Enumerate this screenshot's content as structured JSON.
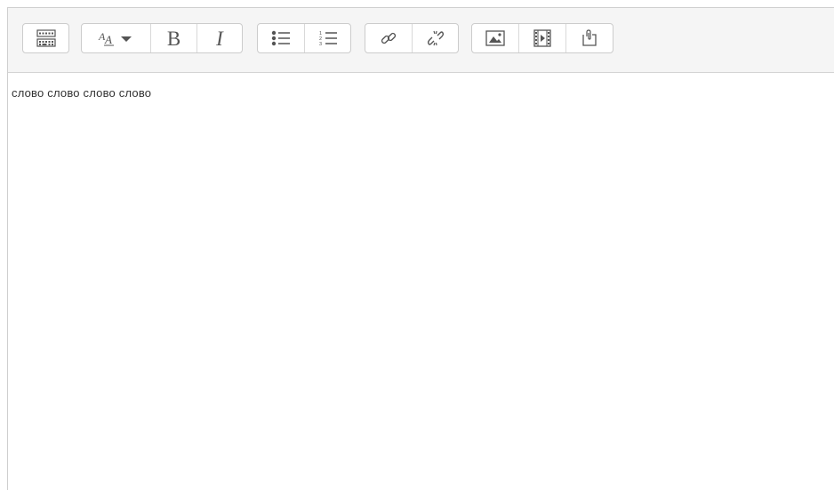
{
  "toolbar": {
    "groups": [
      {
        "buttons": [
          "toolbar-toggle-icon"
        ]
      },
      {
        "buttons": [
          "font-style-dropdown-icon",
          "bold-icon",
          "italic-icon"
        ]
      },
      {
        "buttons": [
          "bulleted-list-icon",
          "numbered-list-icon"
        ]
      },
      {
        "buttons": [
          "link-icon",
          "unlink-icon"
        ]
      },
      {
        "buttons": [
          "image-icon",
          "media-icon",
          "manage-files-icon"
        ]
      }
    ],
    "bold_label": "B",
    "italic_label": "I",
    "dropdown_label": "A"
  },
  "editor": {
    "content_text": "слово слово слово слово"
  }
}
